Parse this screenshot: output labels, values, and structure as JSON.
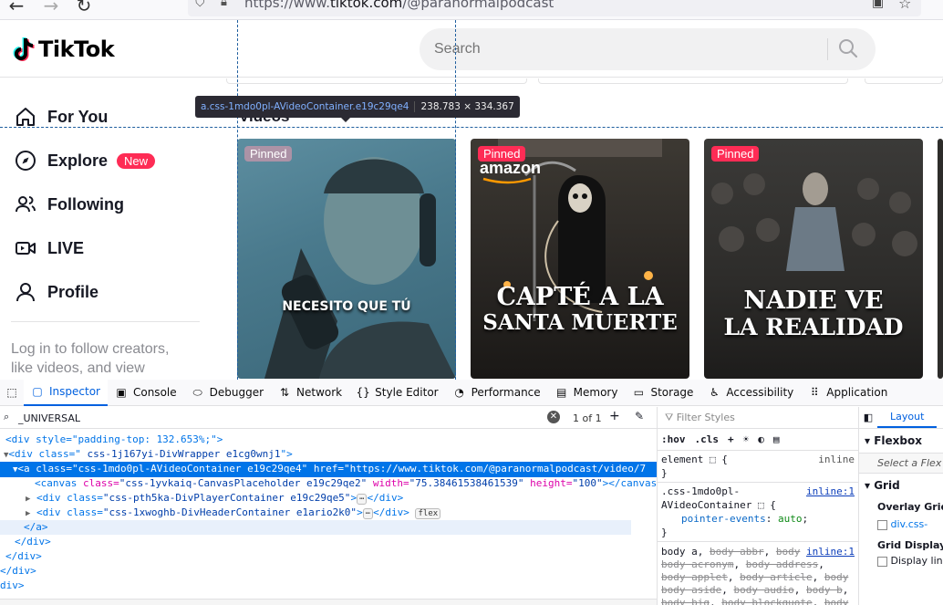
{
  "browser": {
    "url_prefix": "https://www.",
    "url_host": "tiktok.com",
    "url_path": "/@paranormalpodcast"
  },
  "tiktok": {
    "logo_text": "TikTok",
    "search_placeholder": "Search",
    "nav": [
      {
        "label": "For You",
        "icon": "home-icon"
      },
      {
        "label": "Explore",
        "icon": "compass-icon",
        "badge": "New"
      },
      {
        "label": "Following",
        "icon": "users-icon"
      },
      {
        "label": "LIVE",
        "icon": "live-video-icon"
      },
      {
        "label": "Profile",
        "icon": "user-icon"
      }
    ],
    "login_text": "Log in to follow creators, like videos, and view",
    "section_label": "Videos",
    "videos": [
      {
        "pinned": "Pinned",
        "caption": "NECESITO QUE TÚ",
        "brand": ""
      },
      {
        "pinned": "Pinned",
        "caption_line1": "CAPTÉ A LA",
        "caption_line2": "SANTA MUERTE",
        "brand": "amazon"
      },
      {
        "pinned": "Pinned",
        "caption_line1": "NADIE VE",
        "caption_line2": "LA REALIDAD",
        "brand": ""
      }
    ]
  },
  "inspector_tooltip": {
    "selector": "a.css-1mdo0pl-AVideoContainer.e19c29qe4",
    "dimensions": "238.783 × 334.367"
  },
  "devtools": {
    "tabs": [
      {
        "label": "Inspector",
        "icon": "inspector-icon"
      },
      {
        "label": "Console",
        "icon": "console-icon"
      },
      {
        "label": "Debugger",
        "icon": "debugger-icon"
      },
      {
        "label": "Network",
        "icon": "network-icon"
      },
      {
        "label": "Style Editor",
        "icon": "style-editor-icon"
      },
      {
        "label": "Performance",
        "icon": "performance-icon"
      },
      {
        "label": "Memory",
        "icon": "memory-icon"
      },
      {
        "label": "Storage",
        "icon": "storage-icon"
      },
      {
        "label": "Accessibility",
        "icon": "accessibility-icon"
      },
      {
        "label": "Application",
        "icon": "application-icon"
      }
    ],
    "search_value": "_UNIVERSAL",
    "search_count": "1 of 1",
    "markup": {
      "line0": "<div style=\"padding-top: 132.653%;\">",
      "line1_tag": "<div class=\"",
      "line1_val": " css-1j167yi-DivWrapper e1cg0wnj1",
      "line1_end": "\">",
      "line2": "<a class=\"css-1mdo0pl-AVideoContainer e19c29qe4\" href=\"https://www.tiktok.com/@paranormalpodcast/video/7",
      "line3_tag": "<canvas",
      "line3_a1": "class=",
      "line3_v1": "\"css-1yvkaiq-CanvasPlaceholder e19c29qe2\"",
      "line3_a2": "width=",
      "line3_v2": "\"75.38461538461539\"",
      "line3_a3": "height=",
      "line3_v3": "\"100\"",
      "line3_end": "></canvas",
      "line4_tag": "<div class=",
      "line4_val": "\"css-pth5ka-DivPlayerContainer e19c29qe5\"",
      "line4_end": "</div>",
      "line5_tag": "<div class=",
      "line5_val": "\"css-1xwoghb-DivHeaderContainer e1ario2k0\"",
      "line5_end": "</div>",
      "line5_badge": "flex",
      "line6": "</a>",
      "line7": "</div>",
      "line8": "</div>",
      "line9": "</div>",
      "line10": "div>",
      "ellipsis": "⋯"
    },
    "rules": {
      "filter_placeholder": "Filter Styles",
      "hov": ":hov",
      "cls": ".cls",
      "r1_selector": "element",
      "r1_brace": "{",
      "r1_source": "inline",
      "r1_close": "}",
      "r2_selector_a": ".css-1mdo0pl-",
      "r2_selector_b": "AVideoContainer",
      "r2_source": "inline:1",
      "r2_prop": "pointer-events",
      "r2_value": "auto",
      "r2_close": "}",
      "r3_head": "body a,",
      "r3_source": "inline:1",
      "r3_struck": [
        "body abbr",
        "body acronym",
        "body address",
        "body applet",
        "body article",
        "body aside",
        "body audio",
        "body b",
        "body big",
        "body blockquote",
        "body body"
      ],
      "r3_line1_mid": "body",
      "r3_line2_mid": "body"
    },
    "layout": {
      "tab": "Layout",
      "flexbox": "Flexbox",
      "flex_hint": "Select a Flex c",
      "grid": "Grid",
      "overlay_grid": "Overlay Grid",
      "overlay_item": "div.css-",
      "grid_display": "Grid Display S",
      "display_line": "Display lin"
    }
  },
  "colors": {
    "accent": "#fe2c55",
    "devtools_blue": "#0074e8"
  }
}
